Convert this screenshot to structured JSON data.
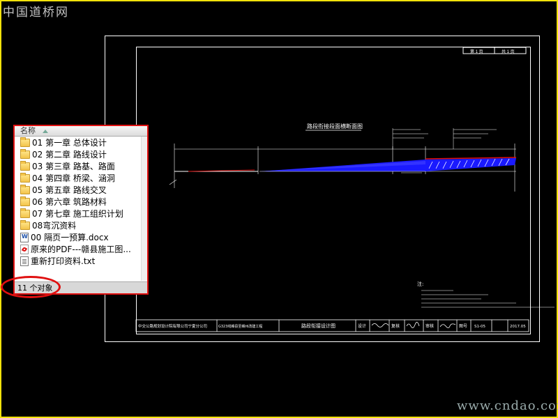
{
  "watermark_top": "中国道桥网",
  "watermark_bottom": "www.cndao.com",
  "explorer": {
    "column_header": "名称",
    "items": [
      {
        "icon": "folder-icon",
        "label": "01 第一章 总体设计"
      },
      {
        "icon": "folder-icon",
        "label": "02 第二章 路线设计"
      },
      {
        "icon": "folder-icon",
        "label": "03 第三章 路基、路面"
      },
      {
        "icon": "folder-icon",
        "label": "04 第四章 桥梁、涵洞"
      },
      {
        "icon": "folder-icon",
        "label": "05 第五章 路线交叉"
      },
      {
        "icon": "folder-icon",
        "label": "06 第六章 筑路材料"
      },
      {
        "icon": "folder-icon",
        "label": "07 第七章 施工组织计划"
      },
      {
        "icon": "folder-icon",
        "label": "08弯沉资料"
      },
      {
        "icon": "word-doc-icon",
        "label": "00 隔页一预算.docx"
      },
      {
        "icon": "pdf-icon",
        "label": "原来的PDF---赣县施工图..."
      },
      {
        "icon": "text-file-icon",
        "label": "重新打印资料.txt"
      }
    ],
    "status": "11 个对象"
  },
  "drawing": {
    "header_cells": [
      "第 1 页",
      "共 1 页"
    ],
    "section_title": "路段衔接段面横断面图",
    "notes_title": "注:",
    "titleblock": {
      "company": "中交公路规划设计院有限公司宁夏分公司",
      "project": "G323线赣县至赣州改建工程",
      "drawing_title": "路段衔接设计图",
      "design": "设计",
      "review": "复核",
      "approve": "审核",
      "sheet_no_label": "图号",
      "sheet_no": "S1-05",
      "date": "2017.05"
    }
  },
  "colors": {
    "frame_border": "#f2e20a",
    "highlight_red": "#e01010",
    "cad_blue": "#1a1aff",
    "cad_background": "#000000"
  }
}
